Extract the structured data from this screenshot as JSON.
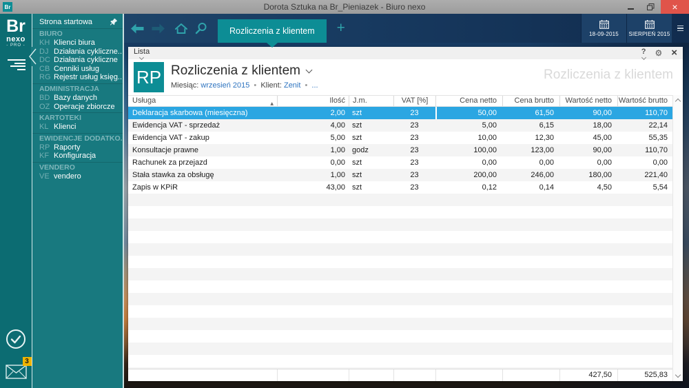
{
  "window": {
    "title": "Dorota Sztuka na Br_Pieniazek - Biuro nexo",
    "app_badge": "Br",
    "close_glyph": "×"
  },
  "rail": {
    "logo_br": "Br",
    "logo_nexo": "nexo",
    "logo_pro": "- PRO -",
    "mail_badge": "3"
  },
  "sidebar": {
    "home_item": "Strona startowa",
    "sections": [
      {
        "header": "BIURO",
        "items": [
          {
            "code": "KH",
            "label": "Klienci biura"
          },
          {
            "code": "DJ",
            "label": "Działania cykliczne..."
          },
          {
            "code": "DC",
            "label": "Działania cykliczne"
          },
          {
            "code": "CB",
            "label": "Cenniki usług"
          },
          {
            "code": "RG",
            "label": "Rejestr usług księg..."
          }
        ]
      },
      {
        "header": "ADMINISTRACJA",
        "items": [
          {
            "code": "BD",
            "label": "Bazy danych"
          },
          {
            "code": "OZ",
            "label": "Operacje zbiorcze"
          }
        ]
      },
      {
        "header": "KARTOTEKI",
        "items": [
          {
            "code": "KL",
            "label": "Klienci"
          }
        ]
      },
      {
        "header": "EWIDENCJE DODATKO...",
        "items": [
          {
            "code": "RP",
            "label": "Raporty"
          },
          {
            "code": "KF",
            "label": "Konfiguracja"
          }
        ]
      },
      {
        "header": "VENDERO",
        "items": [
          {
            "code": "VE",
            "label": "vendero"
          }
        ]
      }
    ]
  },
  "navbar": {
    "active_tab": "Rozliczenia z klientem",
    "new_tab_glyph": "+",
    "date_button": "18-09-2015",
    "month_button": "SIERPIEŃ 2015"
  },
  "panel": {
    "menu_label": "Lista",
    "badge": "RP",
    "title": "Rozliczenia z klientem",
    "watermark": "Rozliczenia z klientem",
    "icons": {
      "help": "?",
      "settings": "⚙",
      "close": "×"
    },
    "filter": {
      "month_label": "Miesiąc:",
      "month_value": "wrzesień 2015",
      "sep1": "•",
      "client_label": "Klient:",
      "client_value": "Zenit",
      "sep2": "•",
      "more": "..."
    }
  },
  "table": {
    "columns": [
      "Usługa",
      "Ilość",
      "J.m.",
      "VAT [%]",
      "Cena netto",
      "Cena brutto",
      "Wartość netto",
      "Wartość brutto"
    ],
    "sort_icon": "▲",
    "selected_index": 0,
    "rows": [
      [
        "Deklaracja skarbowa (miesięczna)",
        "2,00",
        "szt",
        "23",
        "50,00",
        "61,50",
        "90,00",
        "110,70"
      ],
      [
        "Ewidencja VAT - sprzedaż",
        "4,00",
        "szt",
        "23",
        "5,00",
        "6,15",
        "18,00",
        "22,14"
      ],
      [
        "Ewidencja VAT - zakup",
        "5,00",
        "szt",
        "23",
        "10,00",
        "12,30",
        "45,00",
        "55,35"
      ],
      [
        "Konsultacje prawne",
        "1,00",
        "godz",
        "23",
        "100,00",
        "123,00",
        "90,00",
        "110,70"
      ],
      [
        "Rachunek za przejazd",
        "0,00",
        "szt",
        "23",
        "0,00",
        "0,00",
        "0,00",
        "0,00"
      ],
      [
        "Stała stawka za obsługę",
        "1,00",
        "szt",
        "23",
        "200,00",
        "246,00",
        "180,00",
        "221,40"
      ],
      [
        "Zapis w KPiR",
        "43,00",
        "szt",
        "23",
        "0,12",
        "0,14",
        "4,50",
        "5,54"
      ]
    ],
    "summary": {
      "wartosc_netto": "427,50",
      "wartosc_brutto": "525,83"
    }
  },
  "colors": {
    "accent_teal": "#0d8d95",
    "rail_teal": "#0c6c72",
    "sidebar_teal": "#18797f",
    "navbar_navy": "#17395f",
    "selected_row_blue": "#2ba6e2",
    "link_blue": "#2e74c0",
    "close_red": "#e0544a",
    "badge_yellow": "#f0b400"
  }
}
